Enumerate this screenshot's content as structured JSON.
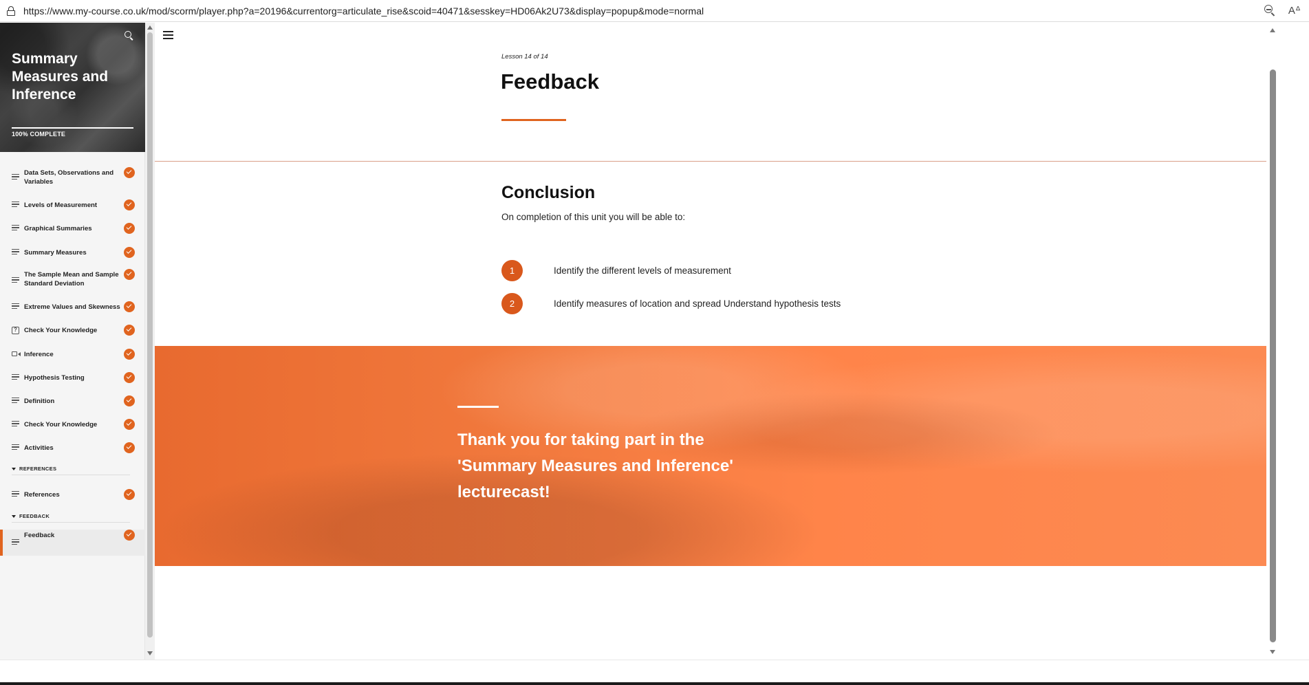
{
  "browser": {
    "url": "https://www.my-course.co.uk/mod/scorm/player.php?a=20196&currentorg=articulate_rise&scoid=40471&sesskey=HD06Ak2U73&display=popup&mode=normal",
    "read_aloud_glyph": "Aᐞ"
  },
  "sidebar": {
    "course_title": "Summary Measures and Inference",
    "progress_fraction": 1.0,
    "progress_label": "100% COMPLETE",
    "items": [
      {
        "label": "Data Sets, Observations and Variables",
        "icon": "lines-icon",
        "complete": true
      },
      {
        "label": "Levels of Measurement",
        "icon": "lines-icon",
        "complete": true
      },
      {
        "label": "Graphical Summaries",
        "icon": "lines-icon",
        "complete": true
      },
      {
        "label": "Summary Measures",
        "icon": "lines-icon",
        "complete": true
      },
      {
        "label": "The Sample Mean and Sample Standard Deviation",
        "icon": "lines-icon",
        "complete": true
      },
      {
        "label": "Extreme Values and Skewness",
        "icon": "lines-icon",
        "complete": true
      },
      {
        "label": "Check Your Knowledge",
        "icon": "quiz-icon",
        "complete": true
      },
      {
        "label": "Inference",
        "icon": "video-icon",
        "complete": true
      },
      {
        "label": "Hypothesis Testing",
        "icon": "lines-icon",
        "complete": true
      },
      {
        "label": "Definition",
        "icon": "lines-icon",
        "complete": true
      },
      {
        "label": "Check Your Knowledge",
        "icon": "lines-icon",
        "complete": true
      },
      {
        "label": "Activities",
        "icon": "lines-icon",
        "complete": true
      }
    ],
    "sections": [
      {
        "heading": "REFERENCES",
        "items": [
          {
            "label": "References",
            "icon": "lines-icon",
            "complete": true
          }
        ]
      },
      {
        "heading": "FEEDBACK",
        "items": [
          {
            "label": "Feedback",
            "icon": "lines-icon",
            "complete": true,
            "active": true
          }
        ]
      }
    ]
  },
  "lesson": {
    "meta": "Lesson 14 of 14",
    "title": "Feedback",
    "conclusion_heading": "Conclusion",
    "conclusion_intro": "On completion of this unit you will be able to:",
    "outcomes": [
      {
        "number": "1",
        "text": "Identify the different levels of measurement"
      },
      {
        "number": "2",
        "text": "Identify measures of location and spread Understand hypothesis tests"
      }
    ],
    "banner_text": "Thank you for taking part in the 'Summary Measures and Inference' lecturecast!"
  },
  "colors": {
    "accent": "#e0641f",
    "banner": "#f27a3e"
  }
}
